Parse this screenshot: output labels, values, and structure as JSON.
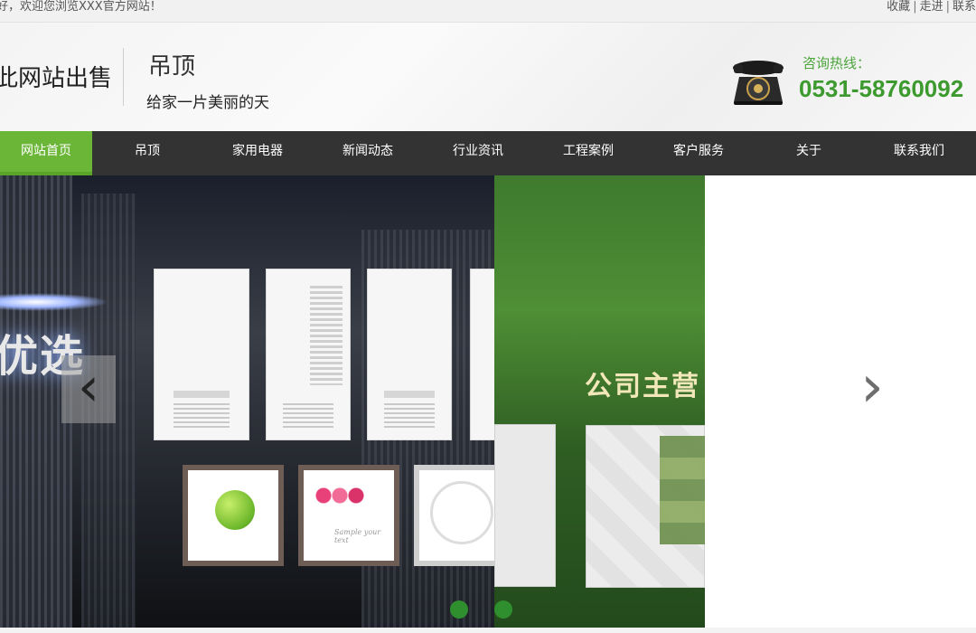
{
  "topbar": {
    "welcome": "好，欢迎您浏览XXX官方网站！",
    "links": [
      "收藏",
      "走进",
      "联系"
    ],
    "separator": "|"
  },
  "header": {
    "site_name": "此网站出售",
    "brand": "吊顶",
    "slogan": "给家一片美丽的天",
    "hotline_label": "咨询热线：",
    "hotline_number": "0531-58760092",
    "icons": {
      "phone": "telephone-icon"
    }
  },
  "nav": {
    "items": [
      "网站首页",
      "吊顶",
      "家用电器",
      "新闻动态",
      "行业资讯",
      "工程案例",
      "客户服务",
      "关于",
      "联系我们"
    ],
    "active_index": 0
  },
  "banner": {
    "slide1_text": "优选",
    "slide2_text": "公司主营",
    "frame_caption": "Sample your text",
    "prev_arrow": "‹",
    "next_arrow": "›",
    "icons": {
      "prev": "chevron-left-icon",
      "next": "chevron-right-icon"
    }
  },
  "colors": {
    "nav_bg": "#333333",
    "nav_active": "#6bb637",
    "hotline": "#3d9a2f",
    "dot": "#2f8f2f"
  }
}
